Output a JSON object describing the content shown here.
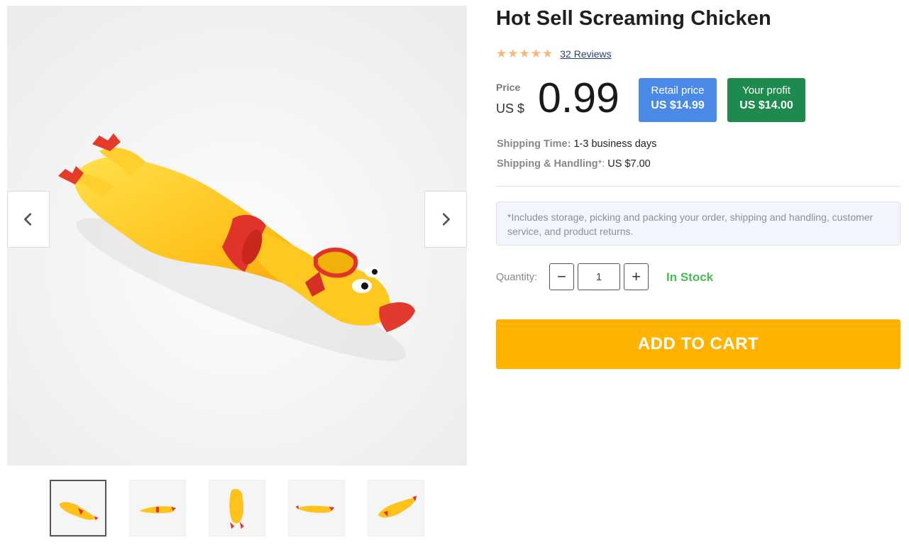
{
  "product": {
    "title": "Hot Sell Screaming Chicken",
    "rating": 4.5,
    "reviews_label": "32 Reviews"
  },
  "pricing": {
    "price_label": "Price",
    "currency": "US $",
    "price": "0.99",
    "retail_label": "Retail price",
    "retail_value": "US $14.99",
    "profit_label": "Your profit",
    "profit_value": "US $14.00",
    "colors": {
      "retail": "#4a8ae6",
      "profit": "#1e8a4e"
    }
  },
  "shipping": {
    "time_label": "Shipping Time:",
    "time_value": "1-3 business days",
    "handling_label": "Shipping & Handling",
    "handling_asterisk": "*:",
    "handling_value": "US $7.00",
    "note": "*Includes storage, picking and packing your order, shipping and handling, customer service, and product returns."
  },
  "quantity": {
    "label": "Quantity:",
    "value": "1",
    "minus_symbol": "−",
    "plus_symbol": "+"
  },
  "stock_status": "In Stock",
  "cart_button": "ADD TO CART",
  "gallery": {
    "prev_icon": "chevron-left-icon",
    "next_icon": "chevron-right-icon",
    "active_thumb": 0,
    "thumb_count": 5
  },
  "colors": {
    "accent": "#ffb300",
    "stock": "#4cb955",
    "star": "#f7b77b"
  }
}
